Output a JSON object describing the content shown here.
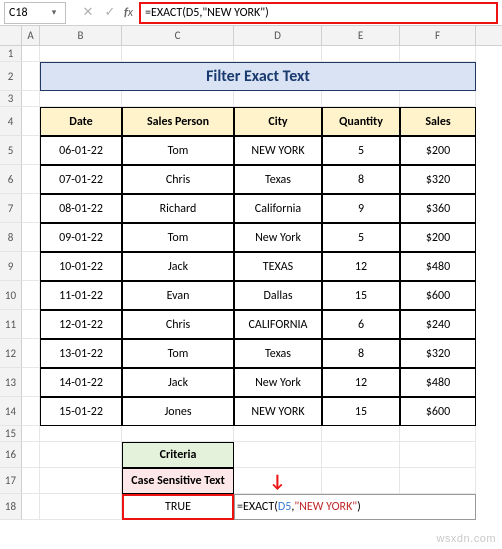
{
  "namebox": "C18",
  "formula_bar": "=EXACT(D5,\"NEW YORK\")",
  "columns": [
    "A",
    "B",
    "C",
    "D",
    "E",
    "F"
  ],
  "title": "Filter Exact Text",
  "headers": {
    "date": "Date",
    "sp": "Sales Person",
    "city": "City",
    "qty": "Quantity",
    "sales": "Sales"
  },
  "rows": [
    {
      "n": "5",
      "date": "06-01-22",
      "sp": "Tom",
      "city": "NEW YORK",
      "qty": "5",
      "sales": "$200"
    },
    {
      "n": "6",
      "date": "07-01-22",
      "sp": "Chris",
      "city": "Texas",
      "qty": "8",
      "sales": "$320"
    },
    {
      "n": "7",
      "date": "08-01-22",
      "sp": "Richard",
      "city": "California",
      "qty": "9",
      "sales": "$360"
    },
    {
      "n": "8",
      "date": "09-01-22",
      "sp": "Tom",
      "city": "New York",
      "qty": "5",
      "sales": "$200"
    },
    {
      "n": "9",
      "date": "10-01-22",
      "sp": "Jack",
      "city": "TEXAS",
      "qty": "12",
      "sales": "$480"
    },
    {
      "n": "10",
      "date": "11-01-22",
      "sp": "Evan",
      "city": "Dallas",
      "qty": "15",
      "sales": "$600"
    },
    {
      "n": "11",
      "date": "12-01-22",
      "sp": "Chris",
      "city": "CALIFORNIA",
      "qty": "6",
      "sales": "$240"
    },
    {
      "n": "12",
      "date": "13-01-22",
      "sp": "Tom",
      "city": "Texas",
      "qty": "8",
      "sales": "$320"
    },
    {
      "n": "13",
      "date": "14-01-22",
      "sp": "Jack",
      "city": "New York",
      "qty": "12",
      "sales": "$480"
    },
    {
      "n": "14",
      "date": "15-01-22",
      "sp": "Jones",
      "city": "NEW YORK",
      "qty": "15",
      "sales": "$600"
    }
  ],
  "criteria_label": "Criteria",
  "criteria_sub": "Case Sensitive Text",
  "criteria_value": "TRUE",
  "inline_formula": {
    "eq": "=",
    "fn": "EXACT(",
    "ref": "D5",
    "comma": ",",
    "str": "\"NEW YORK\"",
    "close": ")"
  },
  "arrow": "↓",
  "watermark": "wsxdn.com"
}
